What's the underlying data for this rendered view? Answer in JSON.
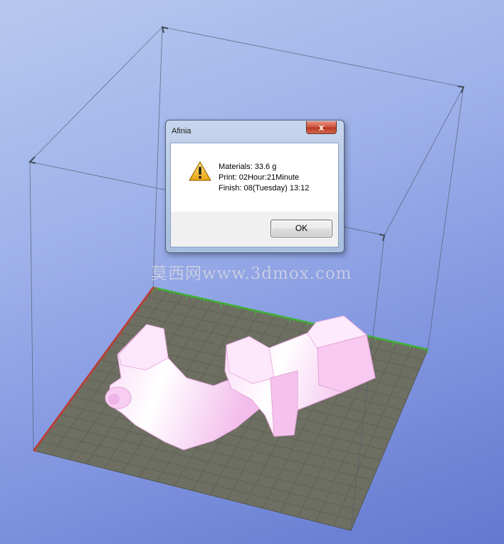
{
  "dialog": {
    "title": "Afinia",
    "close_glyph": "x",
    "icon": "warning-icon",
    "lines": [
      "Materials: 33.6 g",
      "Print: 02Hour:21Minute",
      "Finish: 08(Tuesday) 13:12"
    ],
    "ok_label": "OK"
  },
  "watermark": "莫西网www.3dmox.com",
  "colors": {
    "background_top": "#b7c8ef",
    "background_bottom": "#6478cf",
    "platform": "#6d6f62",
    "grid_line": "#5d5f55",
    "x_axis": "#39b52f",
    "y_axis": "#c2332b",
    "model": "#f5c2ee",
    "model_highlight": "#ffffff",
    "close_button": "#c7462f"
  }
}
